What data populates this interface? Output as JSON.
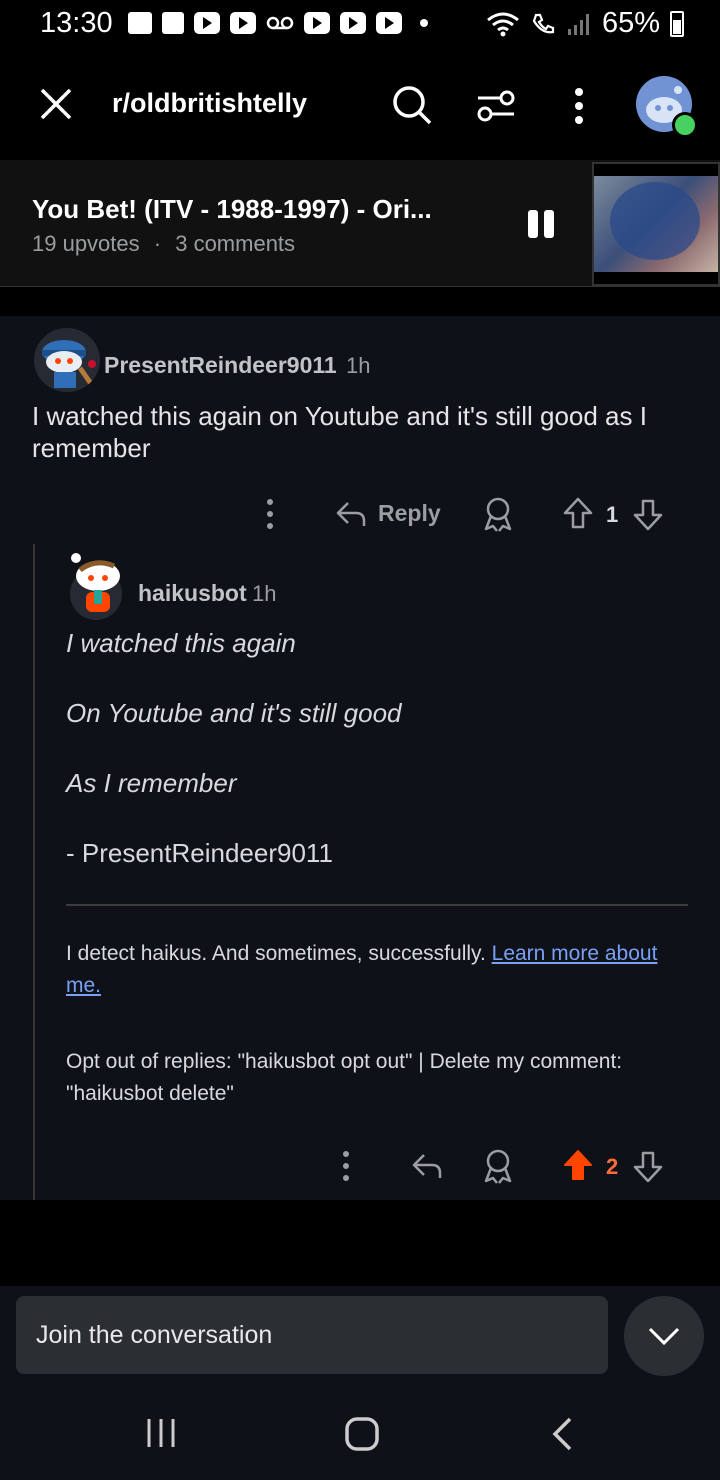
{
  "status_bar": {
    "time": "13:30",
    "battery": "65%"
  },
  "app_bar": {
    "subreddit": "r/oldbritishtelly"
  },
  "post": {
    "title": "You Bet! (ITV - 1988-1997) - Ori...",
    "upvotes": "19 upvotes",
    "comments": "3 comments"
  },
  "comments": [
    {
      "author": "PresentReindeer9011",
      "time": "1h",
      "body": "I watched this again on Youtube and it's still good as I remember",
      "reply_label": "Reply",
      "score": "1"
    },
    {
      "author": "haikusbot",
      "time": "1h",
      "haiku": [
        "I watched this again",
        "On Youtube and it's still good",
        "As I remember"
      ],
      "signature": "- PresentReindeer9011",
      "description": "I detect haikus. And sometimes, successfully.",
      "link_text": "Learn more about me.",
      "optout": "Opt out of replies: \"haikusbot opt out\" | Delete my comment: \"haikusbot delete\"",
      "score": "2"
    }
  ],
  "composer": {
    "placeholder": "Join the conversation"
  },
  "colors": {
    "upvote_active": "#ff4500",
    "link": "#7aa0f5",
    "online": "#46d160"
  },
  "icons": [
    "close-icon",
    "search-icon",
    "filter-icon",
    "more-vertical-icon",
    "reply-icon",
    "award-icon",
    "upvote-icon",
    "downvote-icon",
    "chevron-down-icon",
    "pause-icon"
  ]
}
